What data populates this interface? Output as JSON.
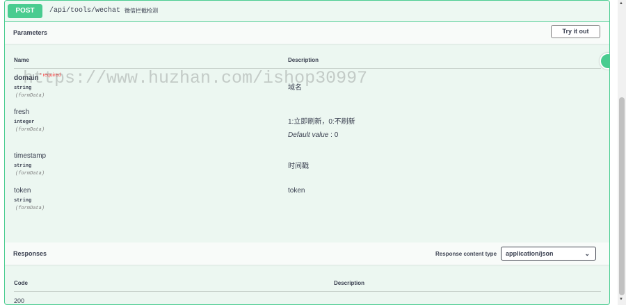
{
  "operation": {
    "method": "POST",
    "path": "/api/tools/wechat",
    "description": "微信拦截检测"
  },
  "parameters": {
    "title": "Parameters",
    "try_label": "Try it out",
    "col_name": "Name",
    "col_description": "Description",
    "items": [
      {
        "name": "domain",
        "required": "* required",
        "type": "string",
        "in": "(formData)",
        "description": "域名"
      },
      {
        "name": "fresh",
        "type": "integer",
        "in": "(formData)",
        "description": "1:立即刷新，0:不刷新",
        "default_label": "Default value",
        "default_value": " : 0"
      },
      {
        "name": "timestamp",
        "type": "string",
        "in": "(formData)",
        "description": "时间戳"
      },
      {
        "name": "token",
        "type": "string",
        "in": "(formData)",
        "description": "token"
      }
    ]
  },
  "responses": {
    "title": "Responses",
    "content_type_label": "Response content type",
    "content_type_value": "application/json",
    "col_code": "Code",
    "col_description": "Description",
    "first_code": "200"
  },
  "watermark": "https://www.huzhan.com/ishop30997",
  "colors": {
    "accent": "#49cc90",
    "block_bg": "#ecf7f1",
    "required": "#ff3333"
  }
}
